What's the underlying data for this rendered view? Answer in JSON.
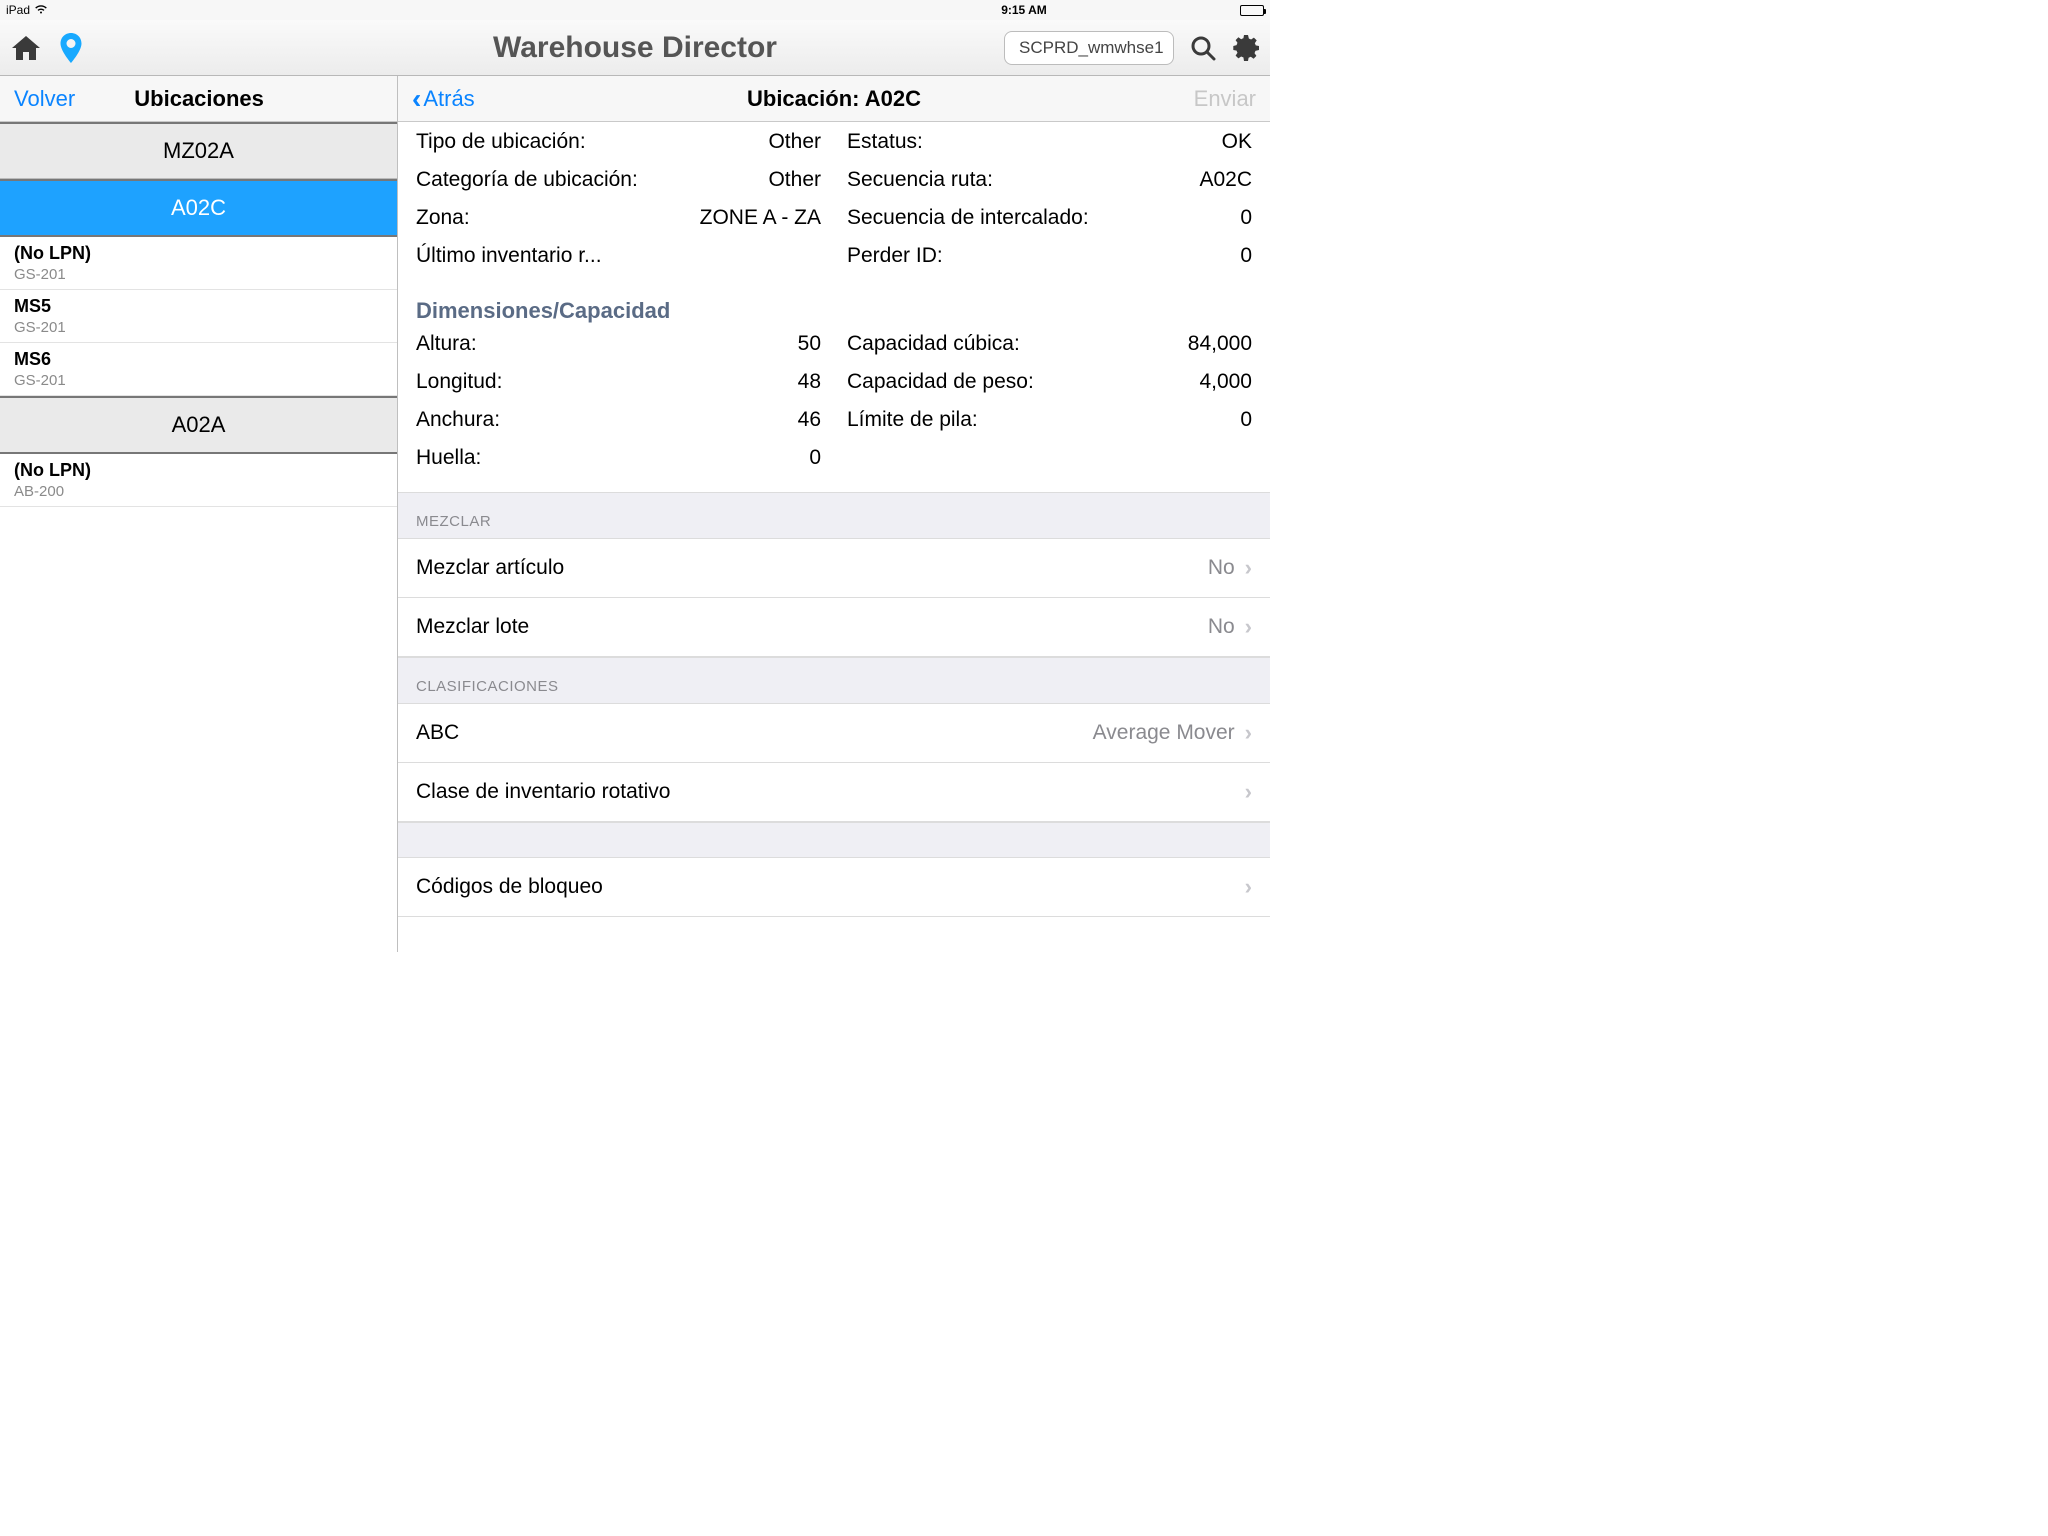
{
  "statusbar": {
    "device": "iPad",
    "time": "9:15 AM"
  },
  "header": {
    "title": "Warehouse Director",
    "warehouse_label": "SCPRD_wmwhse1"
  },
  "leftpane": {
    "back_label": "Volver",
    "title": "Ubicaciones",
    "groups": [
      {
        "loc": "MZ02A",
        "selected": false,
        "items": []
      },
      {
        "loc": "A02C",
        "selected": true,
        "items": [
          {
            "lpn": "(No LPN)",
            "sku": "GS-201"
          },
          {
            "lpn": "MS5",
            "sku": "GS-201"
          },
          {
            "lpn": "MS6",
            "sku": "GS-201"
          }
        ]
      },
      {
        "loc": "A02A",
        "selected": false,
        "items": [
          {
            "lpn": "(No LPN)",
            "sku": "AB-200"
          }
        ]
      }
    ]
  },
  "detail": {
    "back_label": "Atrás",
    "title": "Ubicación: A02C",
    "send_label": "Enviar",
    "kv_left": [
      {
        "k": "Tipo de ubicación:",
        "v": "Other"
      },
      {
        "k": "Categoría de ubicación:",
        "v": "Other"
      },
      {
        "k": "Zona:",
        "v": "ZONE A - ZA"
      },
      {
        "k": "Último inventario r...",
        "v": ""
      }
    ],
    "kv_right": [
      {
        "k": "Estatus:",
        "v": "OK"
      },
      {
        "k": "Secuencia ruta:",
        "v": "A02C"
      },
      {
        "k": "Secuencia de intercalado:",
        "v": "0"
      },
      {
        "k": "Perder ID:",
        "v": "0"
      }
    ],
    "dim_title": "Dimensiones/Capacidad",
    "dim_left": [
      {
        "k": "Altura:",
        "v": "50"
      },
      {
        "k": "Longitud:",
        "v": "48"
      },
      {
        "k": "Anchura:",
        "v": "46"
      },
      {
        "k": "Huella:",
        "v": "0"
      }
    ],
    "dim_right": [
      {
        "k": "Capacidad cúbica:",
        "v": "84,000"
      },
      {
        "k": "Capacidad de peso:",
        "v": "4,000"
      },
      {
        "k": "Límite de pila:",
        "v": "0"
      }
    ],
    "mix_header": "MEZCLAR",
    "mix_rows": [
      {
        "label": "Mezclar artículo",
        "value": "No"
      },
      {
        "label": "Mezclar lote",
        "value": "No"
      }
    ],
    "class_header": "CLASIFICACIONES",
    "class_rows": [
      {
        "label": "ABC",
        "value": "Average Mover"
      },
      {
        "label": "Clase de inventario rotativo",
        "value": ""
      }
    ],
    "hold_row": {
      "label": "Códigos de bloqueo",
      "value": ""
    }
  }
}
